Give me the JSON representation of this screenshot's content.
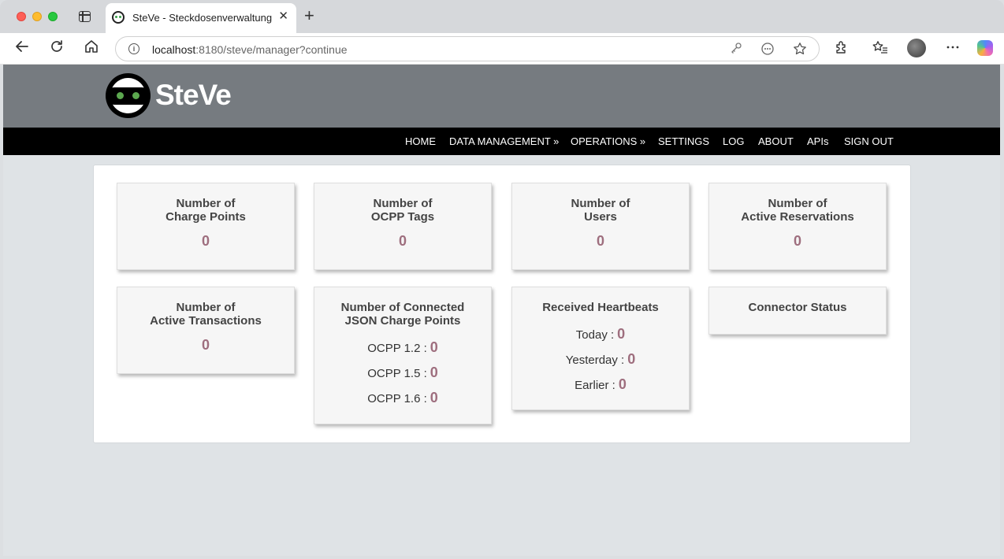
{
  "browser": {
    "tab_title": "SteVe - Steckdosenverwaltung",
    "tab_close": "✕",
    "new_tab": "+",
    "url_host": "localhost",
    "url_rest": ":8180/steve/manager?continue"
  },
  "site": {
    "logo_text": "SteVe",
    "nav": [
      "HOME",
      "DATA MANAGEMENT »",
      "OPERATIONS »",
      "SETTINGS",
      "LOG",
      "ABOUT",
      "APIs",
      "SIGN OUT"
    ]
  },
  "tiles": {
    "charge_points": {
      "line1": "Number of",
      "line2": "Charge Points",
      "value": "0"
    },
    "ocpp_tags": {
      "line1": "Number of",
      "line2": "OCPP Tags",
      "value": "0"
    },
    "users": {
      "line1": "Number of",
      "line2": "Users",
      "value": "0"
    },
    "reservations": {
      "line1": "Number of",
      "line2": "Active Reservations",
      "value": "0"
    },
    "transactions": {
      "line1": "Number of",
      "line2": "Active Transactions",
      "value": "0"
    },
    "json_cp": {
      "line1": "Number of Connected",
      "line2": "JSON Charge Points",
      "rows": [
        {
          "label": "OCPP 1.2 :",
          "value": "0"
        },
        {
          "label": "OCPP 1.5 :",
          "value": "0"
        },
        {
          "label": "OCPP 1.6 :",
          "value": "0"
        }
      ]
    },
    "heartbeats": {
      "title": "Received Heartbeats",
      "rows": [
        {
          "label": "Today :",
          "value": "0"
        },
        {
          "label": "Yesterday :",
          "value": "0"
        },
        {
          "label": "Earlier :",
          "value": "0"
        }
      ]
    },
    "connector_status": {
      "title": "Connector Status"
    }
  },
  "colors": {
    "header_bg": "#767b80",
    "navbar_bg": "#000000",
    "value_color": "#9e6e7e",
    "logo_eye": "#5ca84f"
  }
}
